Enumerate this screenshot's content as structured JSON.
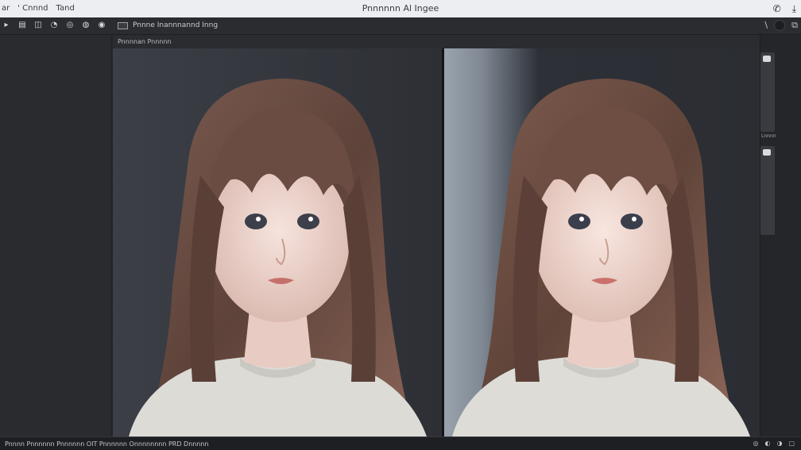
{
  "titlebar": {
    "menu": [
      "ar",
      "' Cnnnd",
      "Tand"
    ],
    "title": "Pnnnnnn Al Ingee",
    "right_icons": [
      "phone-icon",
      "download-icon"
    ]
  },
  "toolbar": {
    "tools": [
      "▸",
      "▤",
      "◫",
      "◔",
      "◎",
      "◍",
      "◉"
    ],
    "document_label": "Pnnne Inannnannd Inng",
    "right_glyph": "\\",
    "right_icons": [
      "brush-icon",
      "record-icon",
      "export-icon"
    ]
  },
  "subheader": {
    "label": "Pnnnnan Pnnnnn"
  },
  "right_dock": {
    "label": "Lnnnn"
  },
  "statusbar": {
    "text": "Pnnnn Pnnnnnn Pnnnnnn OIT Pnnnnnn Onnnnnnnn PRD Dnnnnn",
    "right_icons": [
      "◎",
      "◐",
      "◑",
      "▢"
    ]
  },
  "colors": {
    "accent": "#dadce0",
    "canvas": "#1f2023",
    "panel": "#2a2b2f"
  },
  "image_panes": [
    {
      "name": "original",
      "description": ""
    },
    {
      "name": "enhanced",
      "description": ""
    }
  ]
}
